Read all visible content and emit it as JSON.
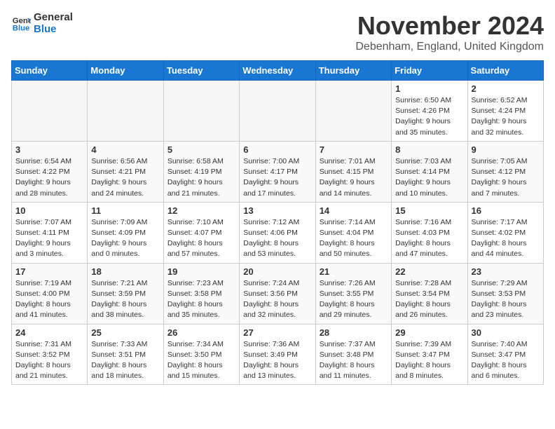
{
  "header": {
    "logo_line1": "General",
    "logo_line2": "Blue",
    "month": "November 2024",
    "location": "Debenham, England, United Kingdom"
  },
  "days_of_week": [
    "Sunday",
    "Monday",
    "Tuesday",
    "Wednesday",
    "Thursday",
    "Friday",
    "Saturday"
  ],
  "weeks": [
    [
      {
        "day": "",
        "info": ""
      },
      {
        "day": "",
        "info": ""
      },
      {
        "day": "",
        "info": ""
      },
      {
        "day": "",
        "info": ""
      },
      {
        "day": "",
        "info": ""
      },
      {
        "day": "1",
        "info": "Sunrise: 6:50 AM\nSunset: 4:26 PM\nDaylight: 9 hours\nand 35 minutes."
      },
      {
        "day": "2",
        "info": "Sunrise: 6:52 AM\nSunset: 4:24 PM\nDaylight: 9 hours\nand 32 minutes."
      }
    ],
    [
      {
        "day": "3",
        "info": "Sunrise: 6:54 AM\nSunset: 4:22 PM\nDaylight: 9 hours\nand 28 minutes."
      },
      {
        "day": "4",
        "info": "Sunrise: 6:56 AM\nSunset: 4:21 PM\nDaylight: 9 hours\nand 24 minutes."
      },
      {
        "day": "5",
        "info": "Sunrise: 6:58 AM\nSunset: 4:19 PM\nDaylight: 9 hours\nand 21 minutes."
      },
      {
        "day": "6",
        "info": "Sunrise: 7:00 AM\nSunset: 4:17 PM\nDaylight: 9 hours\nand 17 minutes."
      },
      {
        "day": "7",
        "info": "Sunrise: 7:01 AM\nSunset: 4:15 PM\nDaylight: 9 hours\nand 14 minutes."
      },
      {
        "day": "8",
        "info": "Sunrise: 7:03 AM\nSunset: 4:14 PM\nDaylight: 9 hours\nand 10 minutes."
      },
      {
        "day": "9",
        "info": "Sunrise: 7:05 AM\nSunset: 4:12 PM\nDaylight: 9 hours\nand 7 minutes."
      }
    ],
    [
      {
        "day": "10",
        "info": "Sunrise: 7:07 AM\nSunset: 4:11 PM\nDaylight: 9 hours\nand 3 minutes."
      },
      {
        "day": "11",
        "info": "Sunrise: 7:09 AM\nSunset: 4:09 PM\nDaylight: 9 hours\nand 0 minutes."
      },
      {
        "day": "12",
        "info": "Sunrise: 7:10 AM\nSunset: 4:07 PM\nDaylight: 8 hours\nand 57 minutes."
      },
      {
        "day": "13",
        "info": "Sunrise: 7:12 AM\nSunset: 4:06 PM\nDaylight: 8 hours\nand 53 minutes."
      },
      {
        "day": "14",
        "info": "Sunrise: 7:14 AM\nSunset: 4:04 PM\nDaylight: 8 hours\nand 50 minutes."
      },
      {
        "day": "15",
        "info": "Sunrise: 7:16 AM\nSunset: 4:03 PM\nDaylight: 8 hours\nand 47 minutes."
      },
      {
        "day": "16",
        "info": "Sunrise: 7:17 AM\nSunset: 4:02 PM\nDaylight: 8 hours\nand 44 minutes."
      }
    ],
    [
      {
        "day": "17",
        "info": "Sunrise: 7:19 AM\nSunset: 4:00 PM\nDaylight: 8 hours\nand 41 minutes."
      },
      {
        "day": "18",
        "info": "Sunrise: 7:21 AM\nSunset: 3:59 PM\nDaylight: 8 hours\nand 38 minutes."
      },
      {
        "day": "19",
        "info": "Sunrise: 7:23 AM\nSunset: 3:58 PM\nDaylight: 8 hours\nand 35 minutes."
      },
      {
        "day": "20",
        "info": "Sunrise: 7:24 AM\nSunset: 3:56 PM\nDaylight: 8 hours\nand 32 minutes."
      },
      {
        "day": "21",
        "info": "Sunrise: 7:26 AM\nSunset: 3:55 PM\nDaylight: 8 hours\nand 29 minutes."
      },
      {
        "day": "22",
        "info": "Sunrise: 7:28 AM\nSunset: 3:54 PM\nDaylight: 8 hours\nand 26 minutes."
      },
      {
        "day": "23",
        "info": "Sunrise: 7:29 AM\nSunset: 3:53 PM\nDaylight: 8 hours\nand 23 minutes."
      }
    ],
    [
      {
        "day": "24",
        "info": "Sunrise: 7:31 AM\nSunset: 3:52 PM\nDaylight: 8 hours\nand 21 minutes."
      },
      {
        "day": "25",
        "info": "Sunrise: 7:33 AM\nSunset: 3:51 PM\nDaylight: 8 hours\nand 18 minutes."
      },
      {
        "day": "26",
        "info": "Sunrise: 7:34 AM\nSunset: 3:50 PM\nDaylight: 8 hours\nand 15 minutes."
      },
      {
        "day": "27",
        "info": "Sunrise: 7:36 AM\nSunset: 3:49 PM\nDaylight: 8 hours\nand 13 minutes."
      },
      {
        "day": "28",
        "info": "Sunrise: 7:37 AM\nSunset: 3:48 PM\nDaylight: 8 hours\nand 11 minutes."
      },
      {
        "day": "29",
        "info": "Sunrise: 7:39 AM\nSunset: 3:47 PM\nDaylight: 8 hours\nand 8 minutes."
      },
      {
        "day": "30",
        "info": "Sunrise: 7:40 AM\nSunset: 3:47 PM\nDaylight: 8 hours\nand 6 minutes."
      }
    ]
  ]
}
